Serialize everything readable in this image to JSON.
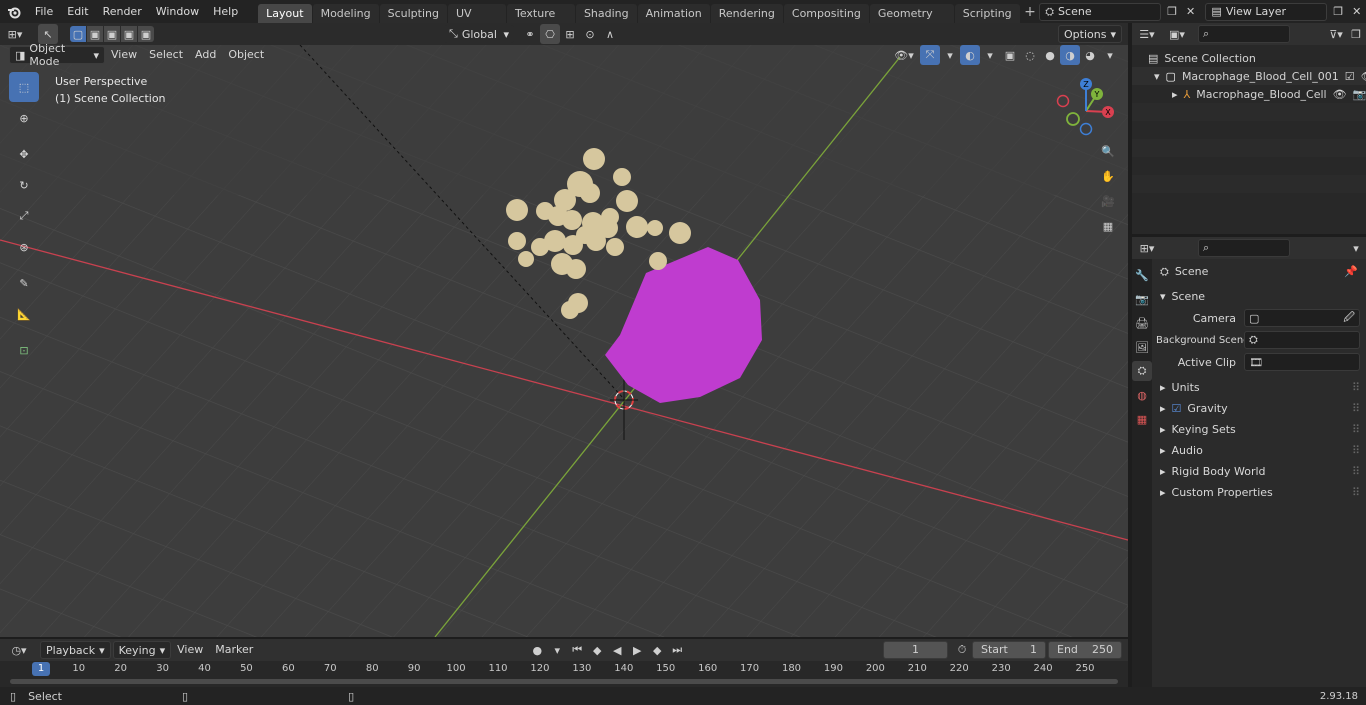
{
  "menu": {
    "file": "File",
    "edit": "Edit",
    "render": "Render",
    "window": "Window",
    "help": "Help"
  },
  "workspaces": [
    "Layout",
    "Modeling",
    "Sculpting",
    "UV Editing",
    "Texture Paint",
    "Shading",
    "Animation",
    "Rendering",
    "Compositing",
    "Geometry Nodes",
    "Scripting"
  ],
  "active_workspace": "Layout",
  "scene_field": "Scene",
  "view_layer_field": "View Layer",
  "viewport": {
    "mode": "Object Mode",
    "view": "View",
    "select": "Select",
    "add": "Add",
    "object": "Object",
    "transform_orientation": "Global",
    "options": "Options",
    "overlay_title": "User Perspective",
    "overlay_collection": "(1) Scene Collection",
    "gizmo_x": "X",
    "gizmo_y": "Y",
    "gizmo_z": "Z"
  },
  "outliner": {
    "scene_collection": "Scene Collection",
    "items": [
      {
        "label": "Macrophage_Blood_Cell_001"
      },
      {
        "label": "Macrophage_Blood_Cell"
      }
    ]
  },
  "properties": {
    "header": "Scene",
    "section": "Scene",
    "camera_label": "Camera",
    "background_label": "Background Scene",
    "clip_label": "Active Clip",
    "panels": [
      "Units",
      "Gravity",
      "Keying Sets",
      "Audio",
      "Rigid Body World",
      "Custom Properties"
    ],
    "gravity_checked": true
  },
  "timeline": {
    "playback": "Playback",
    "keying": "Keying",
    "view": "View",
    "marker": "Marker",
    "current_frame": "1",
    "start_label": "Start",
    "start": "1",
    "end_label": "End",
    "end": "250",
    "ticks": [
      "1",
      "10",
      "20",
      "30",
      "40",
      "50",
      "60",
      "70",
      "80",
      "90",
      "100",
      "110",
      "120",
      "130",
      "140",
      "150",
      "160",
      "170",
      "180",
      "190",
      "200",
      "210",
      "220",
      "230",
      "240",
      "250"
    ]
  },
  "status": {
    "select": "Select",
    "version": "2.93.18"
  },
  "colors": {
    "accent": "#4772b3",
    "cell": "#bf3ccf",
    "particles": "#d6c79e",
    "x_axis": "#c8414f",
    "y_axis": "#7aa33a"
  }
}
